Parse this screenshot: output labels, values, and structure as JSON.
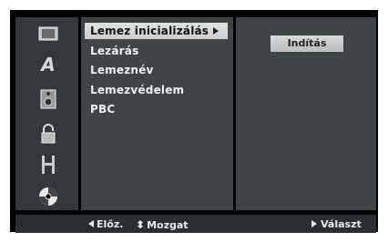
{
  "sidebar": {
    "icons": [
      {
        "name": "film-icon"
      },
      {
        "name": "language-letter-icon",
        "glyph": "A"
      },
      {
        "name": "speaker-icon"
      },
      {
        "name": "lock-icon"
      },
      {
        "name": "film-strip-icon"
      },
      {
        "name": "disc-icon"
      }
    ]
  },
  "menu": {
    "items": [
      {
        "label": "Lemez inicializálás",
        "selected": true
      },
      {
        "label": "Lezárás"
      },
      {
        "label": "Lemeznév"
      },
      {
        "label": "Lemezvédelem"
      },
      {
        "label": "PBC"
      }
    ]
  },
  "actions": {
    "start_label": "Indítás"
  },
  "footer": {
    "prev_label": "Előz.",
    "move_label": "Mozgat",
    "select_label": "Választ"
  },
  "colors": {
    "background": "#000000",
    "panel": "#3f4447",
    "selection": "#d8d8d8",
    "text": "#f0f0f0"
  }
}
